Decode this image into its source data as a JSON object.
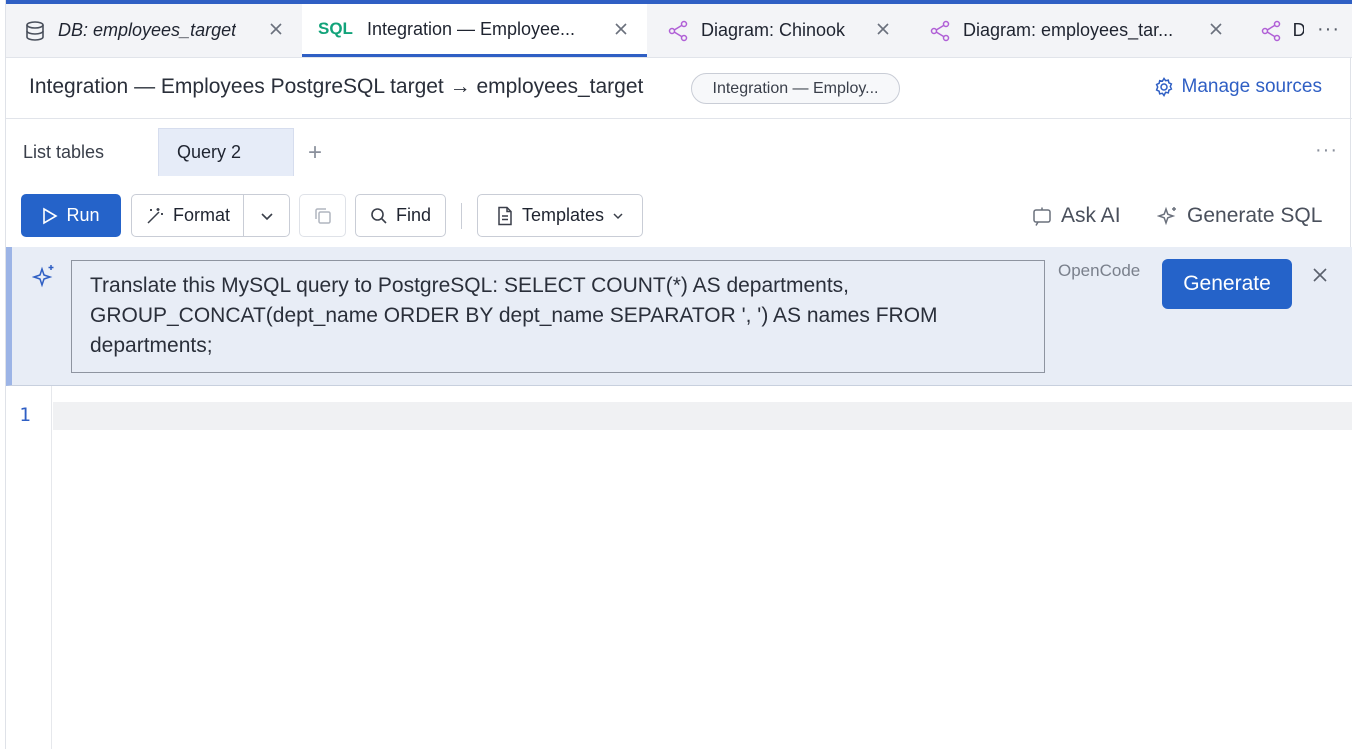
{
  "tabs": [
    {
      "label": "DB: employees_target",
      "icon": "database-icon",
      "active": false
    },
    {
      "tag": "SQL",
      "label": "Integration — Employee...",
      "active": true
    },
    {
      "label": "Diagram: Chinook",
      "icon": "diagram-icon",
      "active": false
    },
    {
      "label": "Diagram: employees_tar...",
      "icon": "diagram-icon",
      "active": false
    },
    {
      "label": "D",
      "icon": "diagram-icon",
      "active": false
    }
  ],
  "tabs_more": "···",
  "header": {
    "title": "Integration — Employees PostgreSQL target → employees_target",
    "source_pill": "Integration — Employ...",
    "manage_sources": "Manage sources"
  },
  "query_tabs": [
    {
      "label": "List tables",
      "active": false
    },
    {
      "label": "Query 2",
      "active": true
    }
  ],
  "add_tab": "+",
  "query_more": "···",
  "toolbar": {
    "run": "Run",
    "format": "Format",
    "find": "Find",
    "templates": "Templates",
    "ask_ai": "Ask AI",
    "generate_sql": "Generate SQL"
  },
  "ai_panel": {
    "prompt": "Translate this MySQL query to PostgreSQL: SELECT COUNT(*) AS departments, GROUP_CONCAT(dept_name ORDER BY dept_name SEPARATOR ', ') AS names FROM departments;",
    "provider": "OpenCode",
    "generate": "Generate"
  },
  "editor": {
    "line_numbers": [
      "1"
    ]
  },
  "colors": {
    "accent": "#2563c9",
    "sql_tag": "#12a37a",
    "diagram_icon": "#b05fd6"
  }
}
